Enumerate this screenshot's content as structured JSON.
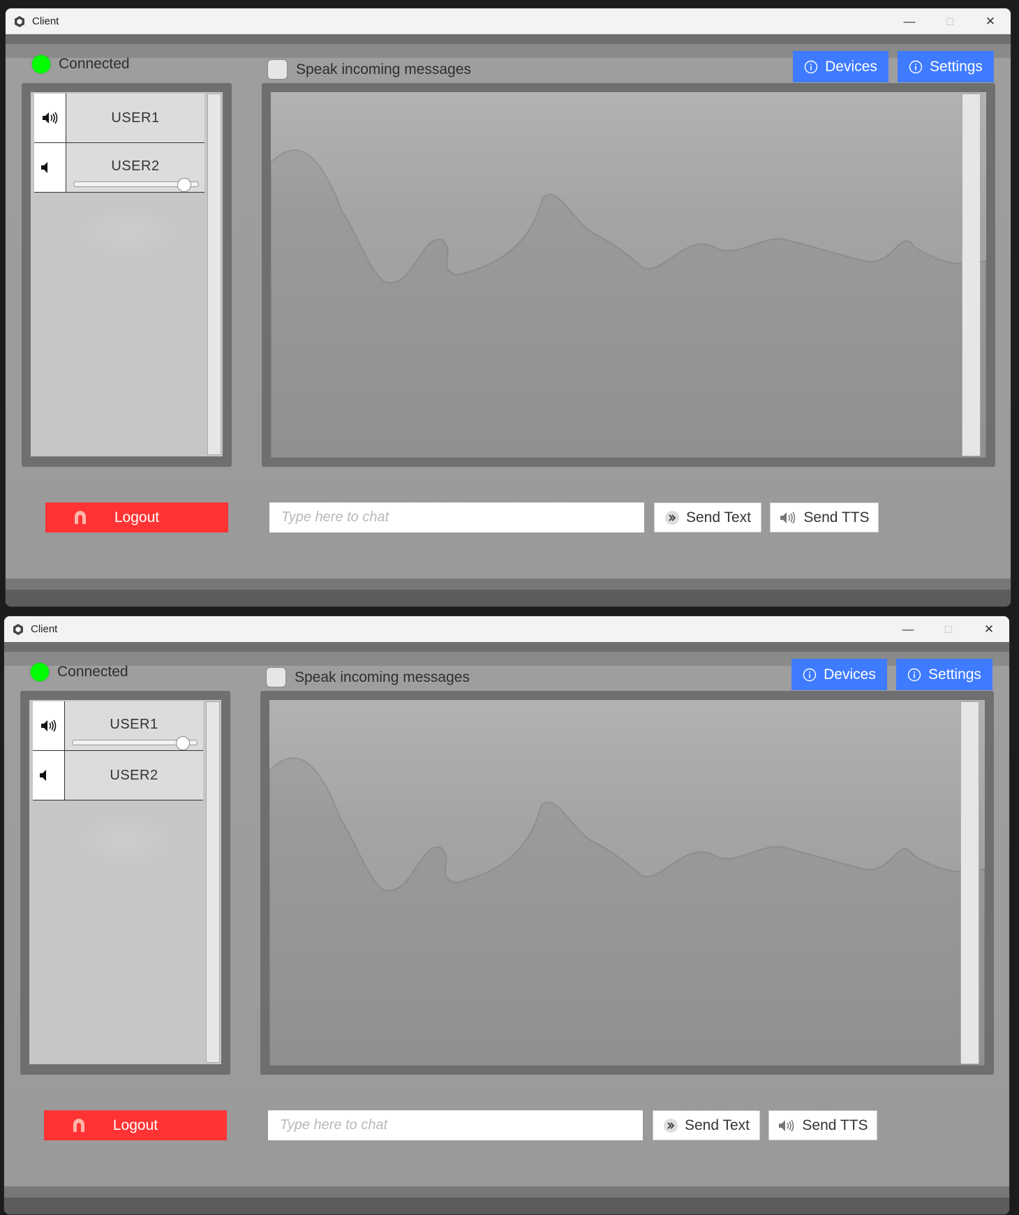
{
  "windows": [
    {
      "title": "Client",
      "status": {
        "label": "Connected",
        "color": "#00ff00"
      },
      "speak_checkbox": {
        "label": "Speak incoming messages",
        "checked": false
      },
      "top_buttons": {
        "devices": "Devices",
        "settings": "Settings"
      },
      "users": [
        {
          "name": "USER1",
          "icon": "speaker-loud-icon",
          "slider_visible": false
        },
        {
          "name": "USER2",
          "icon": "speaker-muted-icon",
          "slider_visible": true,
          "volume": 0.88
        }
      ],
      "chat": {
        "placeholder": "Type here to chat"
      },
      "buttons": {
        "logout": "Logout",
        "send_text": "Send Text",
        "send_tts": "Send TTS"
      }
    },
    {
      "title": "Client",
      "status": {
        "label": "Connected",
        "color": "#00ff00"
      },
      "speak_checkbox": {
        "label": "Speak incoming messages",
        "checked": false
      },
      "top_buttons": {
        "devices": "Devices",
        "settings": "Settings"
      },
      "users": [
        {
          "name": "USER1",
          "icon": "speaker-loud-icon",
          "slider_visible": true,
          "volume": 0.88
        },
        {
          "name": "USER2",
          "icon": "speaker-muted-icon",
          "slider_visible": false
        }
      ],
      "chat": {
        "placeholder": "Type here to chat"
      },
      "buttons": {
        "logout": "Logout",
        "send_text": "Send Text",
        "send_tts": "Send TTS"
      }
    }
  ],
  "colors": {
    "accent": "#3f7bff",
    "logout": "#ff3333",
    "connected": "#00ff00"
  }
}
